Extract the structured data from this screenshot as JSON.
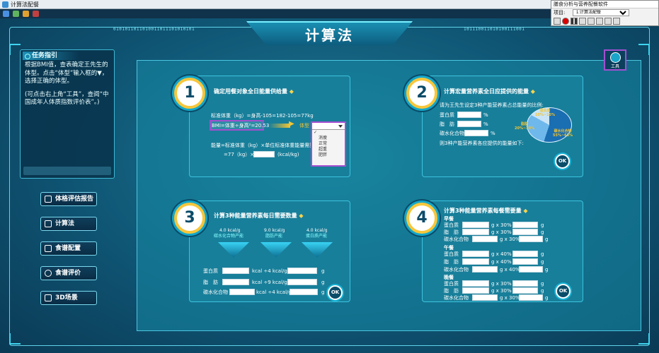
{
  "window": {
    "title": "计算法配餐"
  },
  "tool_window": {
    "title": "膳食分析与营养配餐软件",
    "item_label": "项目:",
    "item_value": "1:计算法配餐"
  },
  "binary": {
    "left": "0101011011010011011101010101",
    "right": "101110011010100111001"
  },
  "page_title": "计算法",
  "task": {
    "heading": "任务指引",
    "text1": "根据BMI值，查表确定王先生的体型。点击“体型”输入框的▼，选择正确的体型。",
    "text2": "(可点击右上角“工具”，查阅“中国成年人体质指数评价表”。)"
  },
  "tool_button": {
    "label": "工具"
  },
  "nav": [
    "体格评估报告",
    "计算法",
    "食谱配置",
    "食谱评价",
    "3D场景"
  ],
  "card1": {
    "num": "1",
    "title": "确定用餐对象全日能量供给量",
    "diamond": "◆",
    "line1": "标准体重（kg）=身高-105=182-105=77kg",
    "bmi": "BMI=体重÷身高²=20.53",
    "shape_label": "体型",
    "line3": "能量=标准体重（kg）×单位标准体重能量需要量",
    "line4a": "=77（kg）×",
    "line4b": "(kcal/kg)",
    "dropdown_options": [
      "消瘦",
      "正常",
      "超重",
      "肥胖"
    ]
  },
  "card2": {
    "num": "2",
    "title": "计算宏量营养素全日应提供的能量",
    "desc": "请为王先生设定3种产能营养素占总能量的比例:",
    "items": [
      "蛋白质",
      "脂　肪",
      "碳水化合物"
    ],
    "pct": "%",
    "outro": "则3种产能营养素各应提供的能量如下:",
    "ok": "OK",
    "pie": {
      "protein": "蛋白质\n10%~15%",
      "fat": "脂肪\n20%~30%",
      "carb": "碳水化合物\n55%~65%",
      "protein_label": "蛋白质",
      "protein_range": "10%~15%",
      "fat_label": "脂肪",
      "fat_range": "20%~30%",
      "carb_label": "碳水化合物",
      "carb_range": "55%~65%"
    }
  },
  "card3": {
    "num": "3",
    "title": "计算3种能量营养素每日需要数量",
    "diamond": "◆",
    "f1a": "4.0 kcal/g",
    "f1b": "碳水化合物产能",
    "f2a": "9.0 kcal/g",
    "f2b": "脂肪产能",
    "f3a": "4.0 kcal/g",
    "f3b": "蛋白质产能",
    "r1": "蛋白质",
    "r2": "脂　肪",
    "r3": "碳水化合物",
    "k1": "kcal ÷4 kcal/g",
    "k2": "kcal ÷9 kcal/g",
    "k3": "kcal ÷4 kcal/g",
    "unit": "g",
    "ok": "OK"
  },
  "card4": {
    "num": "4",
    "title": "计算3种能量营养素每餐需要量",
    "diamond": "◆",
    "breakfast": "早餐",
    "lunch": "午餐",
    "dinner": "晚餐",
    "n1": "蛋白质",
    "n2": "脂　肪",
    "n3": "碳水化合物",
    "x30": "g x 30% =",
    "x40": "g x 40% =",
    "unit": "g",
    "ok": "OK"
  },
  "ok": "OK"
}
